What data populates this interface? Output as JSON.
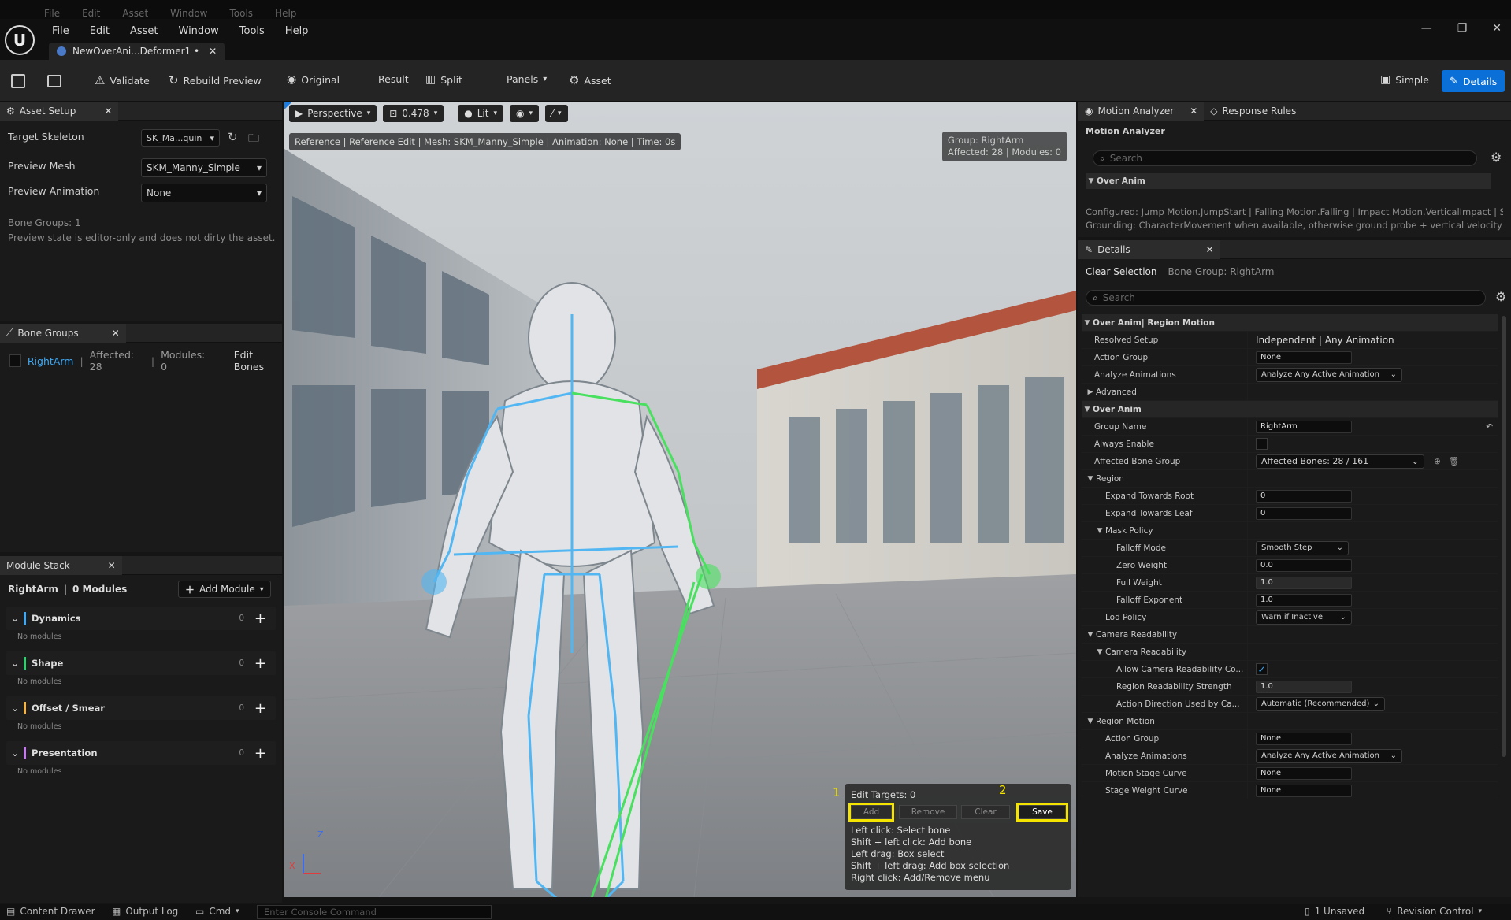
{
  "os_menu": {
    "items": [
      "File",
      "Edit",
      "Asset",
      "Window",
      "Tools",
      "Help"
    ]
  },
  "menu": {
    "items": [
      "File",
      "Edit",
      "Asset",
      "Window",
      "Tools",
      "Help"
    ]
  },
  "doc_tab": {
    "title": "NewOverAni...Deformer1 •"
  },
  "toolbar": {
    "validate": "Validate",
    "rebuild": "Rebuild Preview",
    "original": "Original",
    "result": "Result",
    "split": "Split",
    "panels": "Panels",
    "asset": "Asset",
    "simple": "Simple",
    "details": "Details"
  },
  "asset_setup": {
    "tab": "Asset Setup",
    "target_skeleton_label": "Target Skeleton",
    "target_skeleton_value": "SK_Ma...quin",
    "preview_mesh_label": "Preview Mesh",
    "preview_mesh_value": "SKM_Manny_Simple",
    "preview_anim_label": "Preview Animation",
    "preview_anim_value": "None",
    "info1": "Bone Groups: 1",
    "info2": "Preview state is editor-only and does not dirty the asset."
  },
  "bone_groups": {
    "tab": "Bone Groups",
    "group_name": "RightArm",
    "sep": "|",
    "affected": "Affected: 28",
    "sep2": "|",
    "modules": "Modules: 0",
    "edit": "Edit Bones"
  },
  "module_stack": {
    "tab": "Module Stack",
    "summary_group": "RightArm",
    "summary_sep": "|",
    "summary_count": "0 Modules",
    "add": "Add Module",
    "sections": [
      {
        "name": "Dynamics",
        "count": "0",
        "empty": "No modules",
        "color": "#3fa9f5"
      },
      {
        "name": "Shape",
        "count": "0",
        "empty": "No modules",
        "color": "#2fcf6f"
      },
      {
        "name": "Offset / Smear",
        "count": "0",
        "empty": "No modules",
        "color": "#f5b342"
      },
      {
        "name": "Presentation",
        "count": "0",
        "empty": "No modules",
        "color": "#c779f0"
      }
    ]
  },
  "viewport": {
    "perspective": "Perspective",
    "fov": "0.478",
    "lit": "Lit",
    "info": "Reference | Reference Edit | Mesh: SKM_Manny_Simple | Animation: None | Time: 0s",
    "group_line1": "Group: RightArm",
    "group_line2": "Affected: 28 | Modules: 0",
    "edit_targets": "Edit Targets: 0",
    "add": "Add",
    "remove": "Remove",
    "clear": "Clear",
    "save": "Save",
    "marker1": "1",
    "marker2": "2",
    "help": [
      "Left click: Select bone",
      "Shift + left click: Add bone",
      "Left drag: Box select",
      "Shift + left drag: Add box selection",
      "Right click: Add/Remove menu"
    ],
    "axis_z": "Z",
    "axis_x": "X",
    "highlight_color": "#f5e400"
  },
  "motion_analyzer": {
    "tab1": "Motion Analyzer",
    "tab2": "Response Rules",
    "title": "Motion Analyzer",
    "search": "Search",
    "category": "Over Anim",
    "line1": "Configured: Jump Motion.JumpStart | Falling Motion.Falling | Impact Motion.VerticalImpact | S",
    "line2": "Grounding: CharacterMovement when available, otherwise ground probe + vertical velocity th"
  },
  "details": {
    "tab": "Details",
    "clear_selection": "Clear Selection",
    "bone_group": "Bone Group: RightArm",
    "search": "Search"
  },
  "props": {
    "cat_region_motion": "Over Anim| Region Motion",
    "resolved_setup_label": "Resolved Setup",
    "resolved_setup_value": "Independent | Any Animation",
    "action_group_label": "Action Group",
    "action_group_value": "None",
    "analyze_label": "Analyze Animations",
    "analyze_value": "Analyze Any Active Animation",
    "advanced": "Advanced",
    "cat_over_anim": "Over Anim",
    "group_name_label": "Group Name",
    "group_name_value": "RightArm",
    "always_enable_label": "Always Enable",
    "affected_label": "Affected Bone Group",
    "affected_value": "Affected Bones: 28 / 161",
    "region": "Region",
    "expand_root_label": "Expand Towards Root",
    "expand_root_value": "0",
    "expand_leaf_label": "Expand Towards Leaf",
    "expand_leaf_value": "0",
    "mask_policy": "Mask Policy",
    "falloff_mode_label": "Falloff Mode",
    "falloff_mode_value": "Smooth Step",
    "zero_weight_label": "Zero Weight",
    "zero_weight_value": "0.0",
    "full_weight_label": "Full Weight",
    "full_weight_value": "1.0",
    "falloff_exp_label": "Falloff Exponent",
    "falloff_exp_value": "1.0",
    "lod_policy_label": "Lod Policy",
    "lod_policy_value": "Warn if Inactive",
    "cam_readability": "Camera Readability",
    "cam_readability_sub": "Camera Readability",
    "allow_cam_label": "Allow Camera Readability Co...",
    "region_read_label": "Region Readability Strength",
    "region_read_value": "1.0",
    "action_dir_label": "Action Direction Used by Ca...",
    "action_dir_value": "Automatic (Recommended)",
    "cat_region_motion2": "Region Motion",
    "rm_action_group_label": "Action Group",
    "rm_action_group_value": "None",
    "rm_analyze_label": "Analyze Animations",
    "rm_analyze_value": "Analyze Any Active Animation",
    "motion_stage_label": "Motion Stage Curve",
    "motion_stage_value": "None",
    "stage_weight_label": "Stage Weight Curve",
    "stage_weight_value": "None"
  },
  "statusbar": {
    "content_drawer": "Content Drawer",
    "output_log": "Output Log",
    "cmd": "Cmd",
    "console_placeholder": "Enter Console Command",
    "unsaved": "1 Unsaved",
    "revision": "Revision Control"
  }
}
